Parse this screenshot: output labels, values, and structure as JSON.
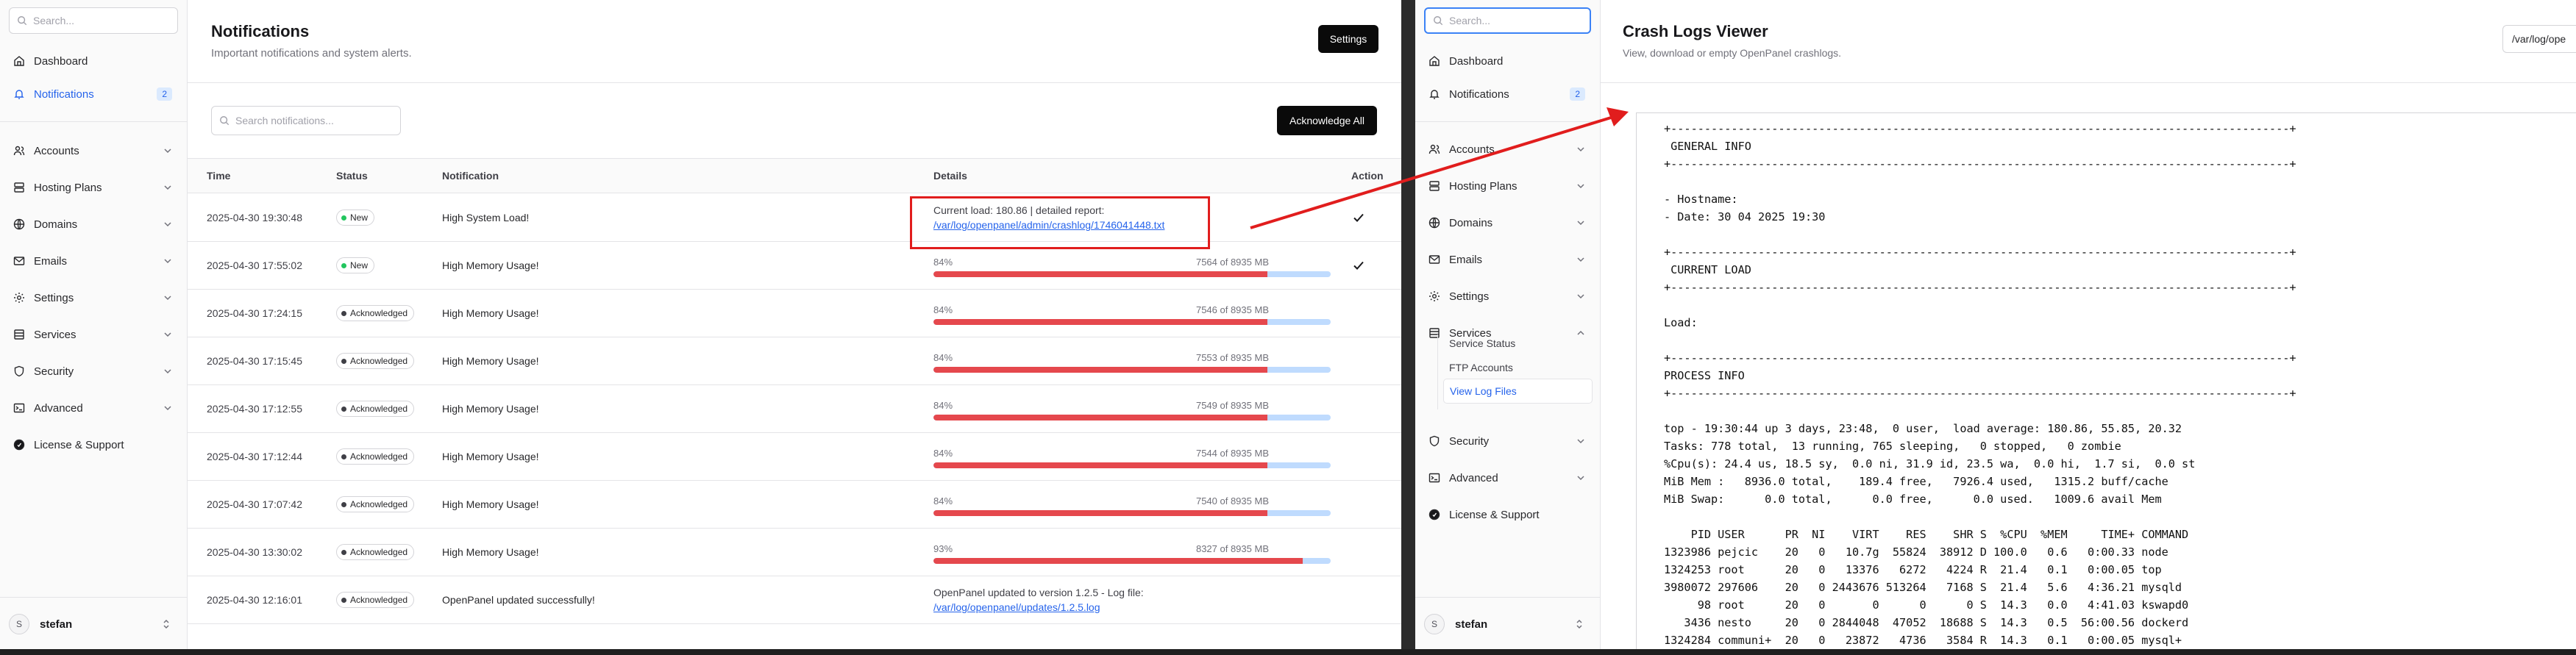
{
  "left": {
    "sidebar": {
      "search_placeholder": "Search...",
      "items": [
        {
          "label": "Dashboard"
        },
        {
          "label": "Notifications",
          "badge": "2"
        },
        {
          "label": "Accounts"
        },
        {
          "label": "Hosting Plans"
        },
        {
          "label": "Domains"
        },
        {
          "label": "Emails"
        },
        {
          "label": "Settings"
        },
        {
          "label": "Services"
        },
        {
          "label": "Security"
        },
        {
          "label": "Advanced"
        },
        {
          "label": "License & Support"
        }
      ],
      "user": {
        "initial": "S",
        "name": "stefan"
      }
    },
    "header": {
      "title": "Notifications",
      "subtitle": "Important notifications and system alerts.",
      "settings_label": "Settings"
    },
    "toolbar": {
      "search_placeholder": "Search notifications...",
      "ack_all_label": "Acknowledge All"
    },
    "table": {
      "columns": [
        "Time",
        "Status",
        "Notification",
        "Details",
        "Action"
      ],
      "rows": [
        {
          "time": "2025-04-30 19:30:48",
          "status": "New",
          "notification": "High System Load!",
          "details_text": "Current load: 180.86 | detailed report:",
          "details_link": "/var/log/openpanel/admin/crashlog/1746041448.txt"
        },
        {
          "time": "2025-04-30 17:55:02",
          "status": "New",
          "notification": "High Memory Usage!",
          "pct": "84%",
          "mem": "7564 of 8935 MB",
          "fill": 0.84
        },
        {
          "time": "2025-04-30 17:24:15",
          "status": "Acknowledged",
          "notification": "High Memory Usage!",
          "pct": "84%",
          "mem": "7546 of 8935 MB",
          "fill": 0.84
        },
        {
          "time": "2025-04-30 17:15:45",
          "status": "Acknowledged",
          "notification": "High Memory Usage!",
          "pct": "84%",
          "mem": "7553 of 8935 MB",
          "fill": 0.84
        },
        {
          "time": "2025-04-30 17:12:55",
          "status": "Acknowledged",
          "notification": "High Memory Usage!",
          "pct": "84%",
          "mem": "7549 of 8935 MB",
          "fill": 0.84
        },
        {
          "time": "2025-04-30 17:12:44",
          "status": "Acknowledged",
          "notification": "High Memory Usage!",
          "pct": "84%",
          "mem": "7544 of 8935 MB",
          "fill": 0.84
        },
        {
          "time": "2025-04-30 17:07:42",
          "status": "Acknowledged",
          "notification": "High Memory Usage!",
          "pct": "84%",
          "mem": "7540 of 8935 MB",
          "fill": 0.84
        },
        {
          "time": "2025-04-30 13:30:02",
          "status": "Acknowledged",
          "notification": "High Memory Usage!",
          "pct": "93%",
          "mem": "8327 of 8935 MB",
          "fill": 0.93
        },
        {
          "time": "2025-04-30 12:16:01",
          "status": "Acknowledged",
          "notification": "OpenPanel updated successfully!",
          "details_text": "OpenPanel updated to version 1.2.5 - Log file:",
          "details_link": "/var/log/openpanel/updates/1.2.5.log"
        }
      ]
    }
  },
  "right": {
    "sidebar": {
      "search_placeholder": "Search...",
      "items": [
        {
          "label": "Dashboard"
        },
        {
          "label": "Notifications",
          "badge": "2"
        },
        {
          "label": "Accounts"
        },
        {
          "label": "Hosting Plans"
        },
        {
          "label": "Domains"
        },
        {
          "label": "Emails"
        },
        {
          "label": "Settings"
        },
        {
          "label": "Services"
        },
        {
          "label": "Security"
        },
        {
          "label": "Advanced"
        },
        {
          "label": "License & Support"
        }
      ],
      "sub_items": [
        {
          "label": "Service Status"
        },
        {
          "label": "FTP Accounts"
        },
        {
          "label": "View Log Files"
        }
      ],
      "user": {
        "initial": "S",
        "name": "stefan"
      }
    },
    "header": {
      "title": "Crash Logs Viewer",
      "subtitle": "View, download or empty OpenPanel crashlogs.",
      "path_select": "/var/log/ope"
    },
    "log_lines": [
      "+--------------------------------------------------------------------------------------------+",
      " GENERAL INFO",
      "+--------------------------------------------------------------------------------------------+",
      "",
      "- Hostname:",
      "- Date: 30 04 2025 19:30",
      "",
      "+--------------------------------------------------------------------------------------------+",
      " CURRENT LOAD",
      "+--------------------------------------------------------------------------------------------+",
      "",
      "Load:",
      "",
      "+--------------------------------------------------------------------------------------------+",
      "PROCESS INFO",
      "+--------------------------------------------------------------------------------------------+",
      "",
      "top - 19:30:44 up 3 days, 23:48,  0 user,  load average: 180.86, 55.85, 20.32",
      "Tasks: 778 total,  13 running, 765 sleeping,   0 stopped,   0 zombie",
      "%Cpu(s): 24.4 us, 18.5 sy,  0.0 ni, 31.9 id, 23.5 wa,  0.0 hi,  1.7 si,  0.0 st",
      "MiB Mem :   8936.0 total,    189.4 free,   7926.4 used,   1315.2 buff/cache",
      "MiB Swap:      0.0 total,      0.0 free,      0.0 used.   1009.6 avail Mem",
      "",
      "    PID USER      PR  NI    VIRT    RES    SHR S  %CPU  %MEM     TIME+ COMMAND",
      "1323986 pejcic    20   0   10.7g  55824  38912 D 100.0   0.6   0:00.33 node",
      "1324253 root      20   0   13376   6272   4224 R  21.4   0.1   0:00.05 top",
      "3980072 297606    20   0 2443676 513264   7168 S  21.4   5.6   4:36.21 mysqld",
      "     98 root      20   0       0      0      0 S  14.3   0.0   4:41.03 kswapd0",
      "   3436 nesto     20   0 2844048  47052  18688 S  14.3   0.5  56:00.56 dockerd",
      "1324284 communi+  20   0   23872   4736   3584 R  14.3   0.1   0:00.05 mysql+"
    ],
    "colors": {
      "annotation": "#e11d1d",
      "link": "#2563eb",
      "bar_fill": "#e5484d",
      "bar_track": "#bfdbfe"
    }
  }
}
